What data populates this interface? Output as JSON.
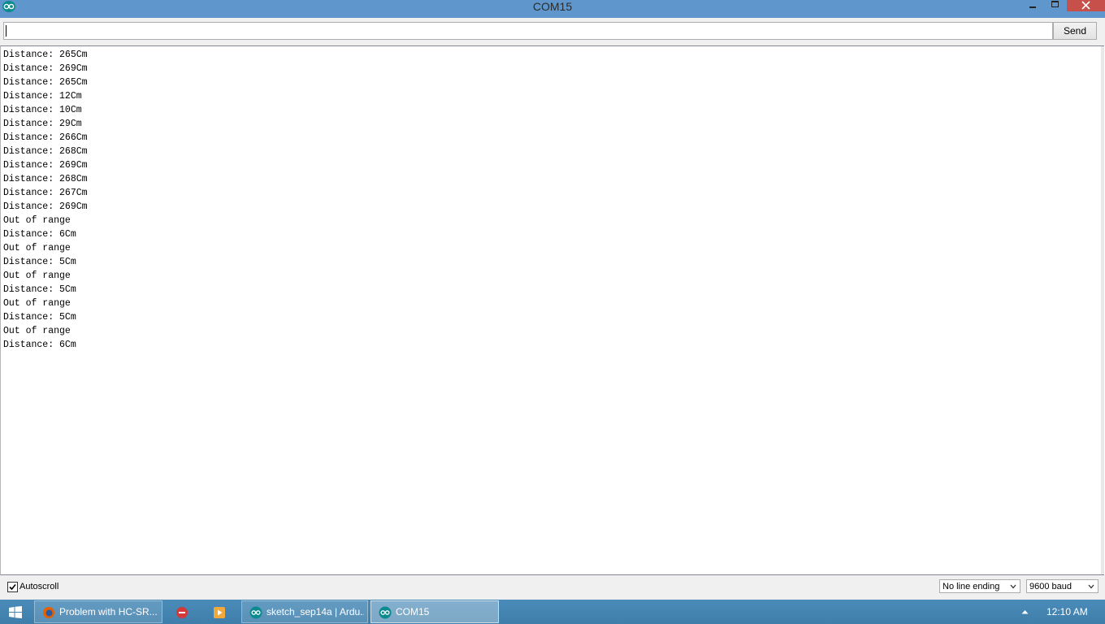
{
  "window": {
    "title": "COM15",
    "icon": "arduino-infinity-icon"
  },
  "colors": {
    "title_bar": "#5f97cc",
    "close_button": "#c7504b",
    "taskbar": "#4585b2"
  },
  "input_row": {
    "value": "",
    "send_label": "Send"
  },
  "output": {
    "lines": [
      "Distance: 265Cm",
      "Distance: 269Cm",
      "Distance: 265Cm",
      "Distance: 12Cm",
      "Distance: 10Cm",
      "Distance: 29Cm",
      "Distance: 266Cm",
      "Distance: 268Cm",
      "Distance: 269Cm",
      "Distance: 268Cm",
      "Distance: 267Cm",
      "Distance: 269Cm",
      "Out of range",
      "Distance: 6Cm",
      "Out of range",
      "Distance: 5Cm",
      "Out of range",
      "Distance: 5Cm",
      "Out of range",
      "Distance: 5Cm",
      "Out of range",
      "Distance: 6Cm"
    ]
  },
  "bottom": {
    "autoscroll_label": "Autoscroll",
    "autoscroll_checked": true,
    "line_ending": "No line ending",
    "baud": "9600 baud"
  },
  "taskbar": {
    "items": [
      {
        "label": "Problem with HC-SR...",
        "icon": "firefox-icon"
      },
      {
        "label": "",
        "icon": "red-circle-app-icon"
      },
      {
        "label": "",
        "icon": "media-player-icon"
      },
      {
        "label": "sketch_sep14a | Ardu...",
        "icon": "arduino-icon"
      },
      {
        "label": "COM15",
        "icon": "arduino-icon"
      }
    ],
    "clock": "12:10 AM"
  }
}
